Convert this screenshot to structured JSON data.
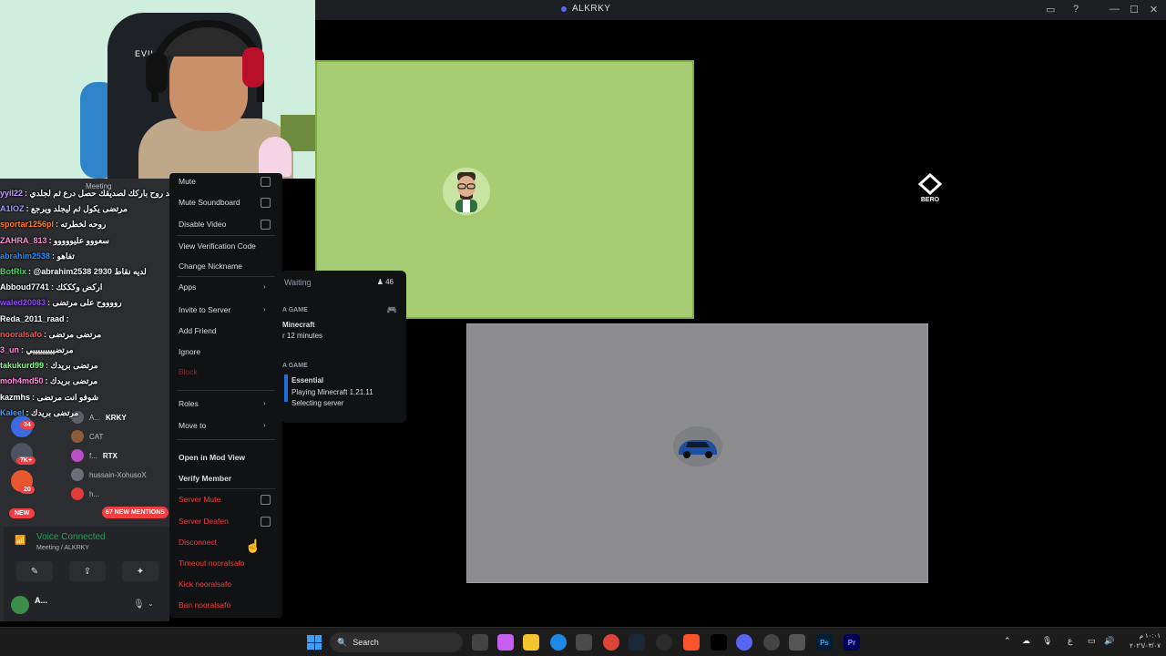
{
  "window": {
    "title": "ALKRKY",
    "controls": [
      "minimize-icon",
      "maximize-icon",
      "close-icon"
    ]
  },
  "stage": {
    "green_tile_color": "#a7cd72",
    "gray_tile_color": "#8c8c8e",
    "bero_label": "BERO"
  },
  "chat": [
    {
      "user": "yyil22",
      "color": "#c59bff",
      "msg": "يسعد روح باركك لصديقك حصل درع ثم لجلدي"
    },
    {
      "user": "A1IOZ",
      "color": "#9b9bff",
      "msg": "مرتضى يكول ثم ليجلد ويرجع"
    },
    {
      "user": "sportar1256pl",
      "color": "#ff7f27",
      "msg": "روحه لخطرته"
    },
    {
      "user": "ZAHRA_813",
      "color": "#ff8ad8",
      "msg": "سعووو عليووووو"
    },
    {
      "user": "abrahim2538",
      "color": "#1e90ff",
      "msg": "تفاهو"
    },
    {
      "user": "BotRix",
      "color": "#4cd964",
      "msg": "@abrahim2538 2930 لديه نقاط"
    },
    {
      "user": "Abboud7741",
      "color": "#ffffff",
      "msg": "اركض وكككك"
    },
    {
      "user": "waled20083",
      "color": "#9147ff",
      "msg": "رووووح على مرتضى"
    },
    {
      "user": "Reda_2011_raad",
      "color": "#ffffff",
      "msg": ""
    },
    {
      "user": "nooralsafo",
      "color": "#ff4f4f",
      "msg": "مرتضى مرتضى"
    },
    {
      "user": "3_un",
      "color": "#ff8ad8",
      "msg": "مرتضيييييييييي"
    },
    {
      "user": "takukurd99",
      "color": "#7dff7d",
      "msg": "مرتضى بريدك"
    },
    {
      "user": "moh4md50",
      "color": "#ff8ad8",
      "msg": "مرتضى بريدك"
    },
    {
      "user": "kazmhs",
      "color": "#ffffff",
      "msg": "شوفو انت مرتضى"
    },
    {
      "user": "Kaleel",
      "color": "#3aa0ff",
      "msg": "مرتضى بريدك"
    }
  ],
  "sidebar": {
    "channel_name": "Meeting",
    "members": [
      {
        "name": "A...",
        "tag": "KRKY"
      },
      {
        "name": "CAT",
        "tag": ""
      },
      {
        "name": "f...",
        "tag": "RTX"
      },
      {
        "name": "hussain-XohusoX",
        "tag": ""
      },
      {
        "name": "h...",
        "tag": ""
      }
    ],
    "badges": [
      "34",
      "7K+",
      "20"
    ],
    "new_label": "NEW",
    "mentions_label": "67 NEW MENTIONS"
  },
  "voice": {
    "status": "Voice Connected",
    "location": "Meeting / ALKRKY",
    "user_name": "A..."
  },
  "activity": {
    "waiting": "Waiting",
    "count": "46",
    "section1_label": "A GAME",
    "game_name": "Minecraft",
    "duration": "r 12 minutes",
    "section2_label": "A GAME",
    "card_title": "Essential",
    "card_line1": "Playing Minecraft 1.21.11",
    "card_line2": "Selecting server"
  },
  "context_menu": {
    "mute": "Mute",
    "mute_soundboard": "Mute Soundboard",
    "disable_video": "Disable Video",
    "view_verification": "View Verification Code",
    "change_nickname": "Change Nickname",
    "apps": "Apps",
    "invite_to_server": "Invite to Server",
    "add_friend": "Add Friend",
    "ignore": "Ignore",
    "block": "Block",
    "roles": "Roles",
    "move_to": "Move to",
    "open_mod_view": "Open in Mod View",
    "verify_member": "Verify Member",
    "server_mute": "Server Mute",
    "server_deafen": "Server Deafen",
    "disconnect": "Disconnect",
    "timeout": "Timeout nooralsafo",
    "kick": "Kick nooralsafo",
    "ban": "Ban nooralsafo"
  },
  "taskbar": {
    "search_placeholder": "Search",
    "tray_lang": "ع",
    "time": "١٠:٠١ م",
    "date": "٢٠٢٦/٠٣/٠٧"
  }
}
